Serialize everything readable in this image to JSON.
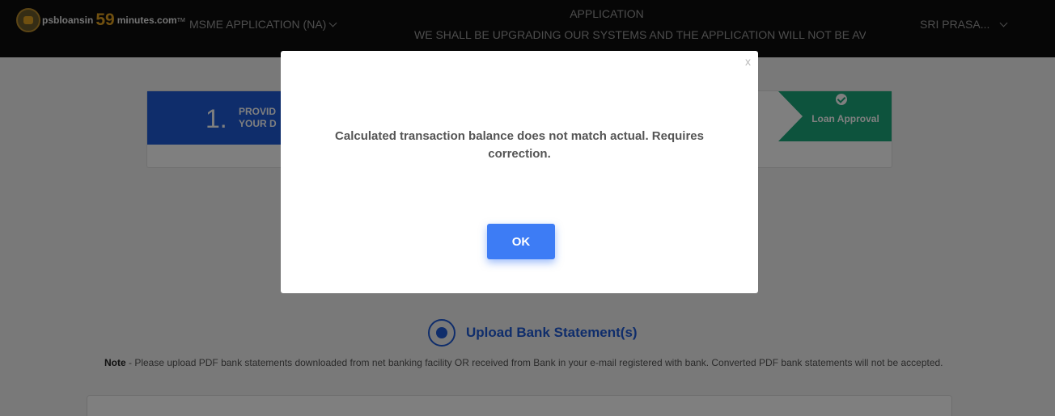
{
  "header": {
    "logo": {
      "text_pre": "psbloansin",
      "text_num": "59",
      "text_post": "minutes.com",
      "tm": "TM"
    },
    "app_menu_label": "MSME APPLICATION (NA)",
    "title": "APPLICATION",
    "ticker": "WE SHALL BE UPGRADING OUR SYSTEMS AND THE APPLICATION WILL NOT BE AVAILAB",
    "user_name": "SRI PRASA..."
  },
  "stepper": {
    "step1": {
      "number": "1.",
      "label_line1": "PROVID",
      "label_line2": "YOUR D"
    },
    "final_step": {
      "label": "Loan Approval"
    }
  },
  "upload": {
    "title": "Upload Bank Statement(s)",
    "note_label": "Note",
    "note_text": " - Please upload PDF bank statements downloaded from net banking facility OR received from Bank in your e-mail registered with bank. Converted PDF bank statements will not be accepted."
  },
  "modal": {
    "close": "x",
    "message": "Calculated transaction balance does not match actual. Requires correction.",
    "ok_label": "OK"
  },
  "colors": {
    "header_bg": "#0d0d0d",
    "primary_blue": "#1e5ad6",
    "ok_button": "#3d7cf5",
    "approval_green": "#1aa67a",
    "overlay": "rgba(0,0,0,0.5)"
  }
}
